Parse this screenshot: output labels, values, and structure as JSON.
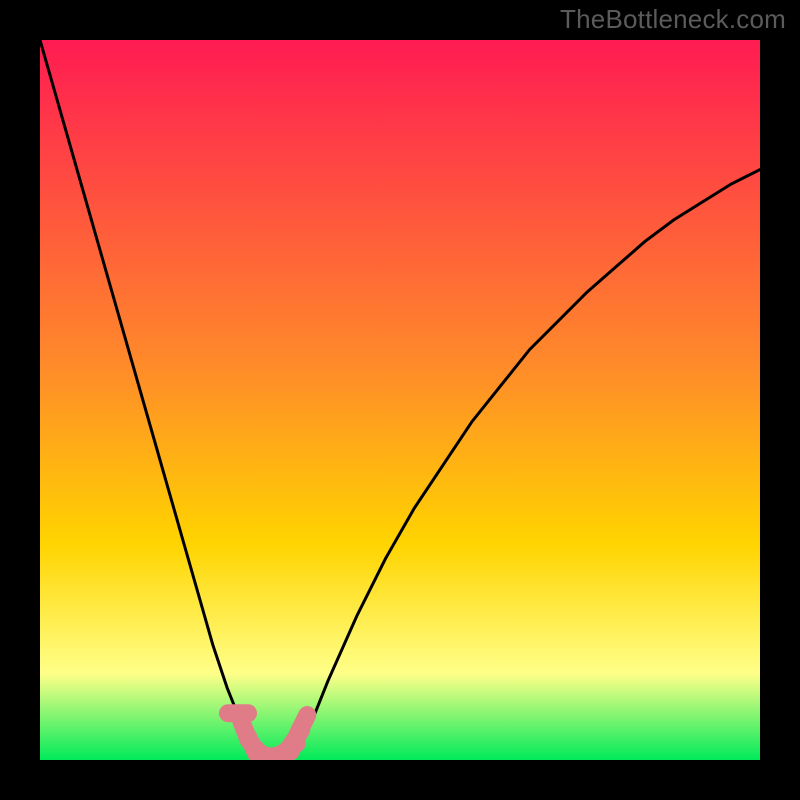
{
  "watermark": "TheBottleneck.com",
  "colors": {
    "frame": "#000000",
    "gradient_top": "#ff1b52",
    "gradient_mid": "#ffd400",
    "gradient_low": "#ffff88",
    "gradient_bottom": "#00ea5a",
    "curve": "#000000",
    "marker_fill": "#e07b88",
    "marker_stroke": "#e07b88"
  },
  "chart_data": {
    "type": "line",
    "title": "",
    "xlabel": "",
    "ylabel": "",
    "xlim": [
      0,
      100
    ],
    "ylim": [
      0,
      100
    ],
    "grid": false,
    "legend": false,
    "annotations": [],
    "series": [
      {
        "name": "bottleneck-curve",
        "x": [
          0,
          2,
          4,
          6,
          8,
          10,
          12,
          14,
          16,
          18,
          20,
          22,
          24,
          26,
          28,
          29,
          30,
          31,
          32,
          33,
          34,
          35,
          36,
          38,
          40,
          44,
          48,
          52,
          56,
          60,
          64,
          68,
          72,
          76,
          80,
          84,
          88,
          92,
          96,
          100
        ],
        "y": [
          100,
          93,
          86,
          79,
          72,
          65,
          58,
          51,
          44,
          37,
          30,
          23,
          16,
          10,
          5,
          3,
          1.5,
          0.5,
          0,
          0,
          0,
          0.5,
          2,
          6,
          11,
          20,
          28,
          35,
          41,
          47,
          52,
          57,
          61,
          65,
          68.5,
          72,
          75,
          77.5,
          80,
          82
        ]
      }
    ],
    "markers": {
      "name": "highlighted-range",
      "shape": "rounded-dash",
      "x": [
        27.5,
        28.5,
        29.5,
        30.5,
        31.5,
        32.5,
        33.5,
        34.5,
        35.5,
        36.5
      ],
      "y": [
        6.5,
        4,
        2,
        1,
        0.5,
        0.5,
        0.8,
        1.5,
        3,
        5
      ]
    }
  }
}
